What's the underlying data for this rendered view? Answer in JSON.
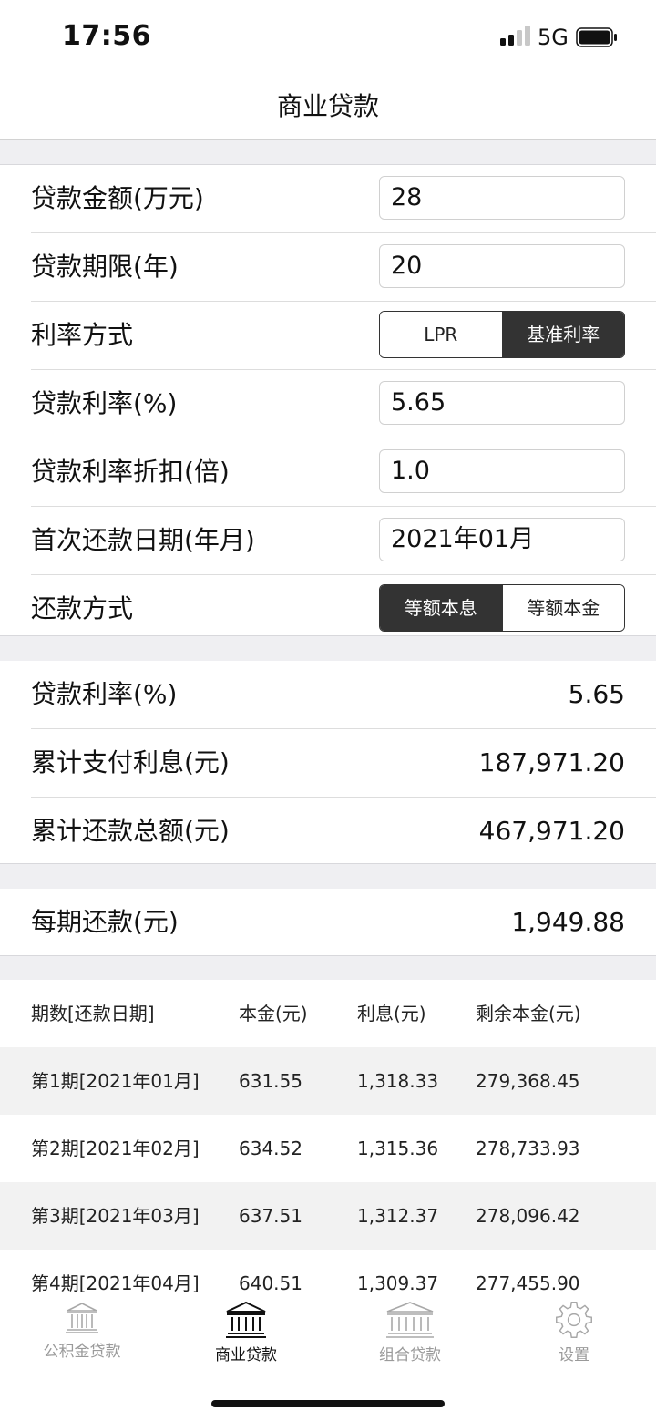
{
  "status_bar": {
    "time": "17:56",
    "network": "5G"
  },
  "nav": {
    "title": "商业贷款"
  },
  "inputs": {
    "loan_amount": {
      "label": "贷款金额(万元)",
      "value": "28"
    },
    "loan_term": {
      "label": "贷款期限(年)",
      "value": "20"
    },
    "rate_method": {
      "label": "利率方式",
      "options": [
        "LPR",
        "基准利率"
      ],
      "selected": "基准利率"
    },
    "loan_rate": {
      "label": "贷款利率(%)",
      "value": "5.65"
    },
    "rate_discount": {
      "label": "贷款利率折扣(倍)",
      "value": "1.0"
    },
    "first_payment_date": {
      "label": "首次还款日期(年月)",
      "value": "2021年01月"
    },
    "repayment_method": {
      "label": "还款方式",
      "options": [
        "等额本息",
        "等额本金"
      ],
      "selected": "等额本息"
    }
  },
  "results": {
    "rate": {
      "label": "贷款利率(%)",
      "value": "5.65"
    },
    "total_interest": {
      "label": "累计支付利息(元)",
      "value": "187,971.20"
    },
    "total_repayment": {
      "label": "累计还款总额(元)",
      "value": "467,971.20"
    }
  },
  "monthly": {
    "label": "每期还款(元)",
    "value": "1,949.88"
  },
  "schedule": {
    "headers": [
      "期数[还款日期]",
      "本金(元)",
      "利息(元)",
      "剩余本金(元)"
    ],
    "rows": [
      [
        "第1期[2021年01月]",
        "631.55",
        "1,318.33",
        "279,368.45"
      ],
      [
        "第2期[2021年02月]",
        "634.52",
        "1,315.36",
        "278,733.93"
      ],
      [
        "第3期[2021年03月]",
        "637.51",
        "1,312.37",
        "278,096.42"
      ],
      [
        "第4期[2021年04月]",
        "640.51",
        "1,309.37",
        "277,455.90"
      ]
    ]
  },
  "tabs": [
    {
      "label": "公积金贷款",
      "icon": "bank-icon",
      "active": false
    },
    {
      "label": "商业贷款",
      "icon": "bank-icon",
      "active": true
    },
    {
      "label": "组合贷款",
      "icon": "bank-icon",
      "active": false
    },
    {
      "label": "设置",
      "icon": "gear-icon",
      "active": false
    }
  ],
  "colors": {
    "active_segment": "#333333",
    "inactive_tab": "#9a9a9a",
    "section_gap": "#efeff2",
    "stripe": "#f2f2f2"
  }
}
